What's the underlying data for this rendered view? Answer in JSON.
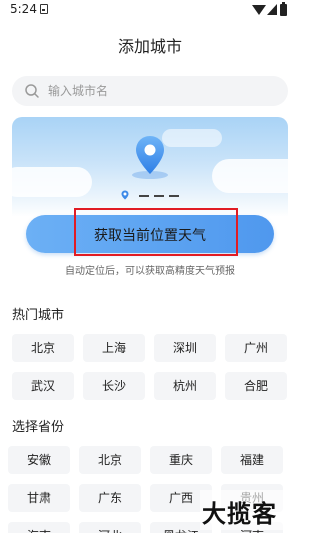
{
  "status_bar": {
    "time": "5:24"
  },
  "title": "添加城市",
  "search": {
    "placeholder": "输入城市名"
  },
  "location": {
    "button_label": "获取当前位置天气",
    "hint": "自动定位后，可以获取高精度天气预报"
  },
  "hot_cities": {
    "title": "热门城市",
    "items": [
      "北京",
      "上海",
      "深圳",
      "广州",
      "武汉",
      "长沙",
      "杭州",
      "合肥"
    ]
  },
  "provinces": {
    "title": "选择省份",
    "items": [
      "安徽",
      "北京",
      "重庆",
      "福建",
      "甘肃",
      "广东",
      "广西",
      "贵州",
      "海南",
      "河北",
      "黑龙江",
      "河南"
    ]
  },
  "watermark": {
    "text": "大揽客"
  },
  "colors": {
    "accent": "#5aa2f1",
    "highlight_border": "#e11c24",
    "chip_bg": "#f4f5f7"
  }
}
